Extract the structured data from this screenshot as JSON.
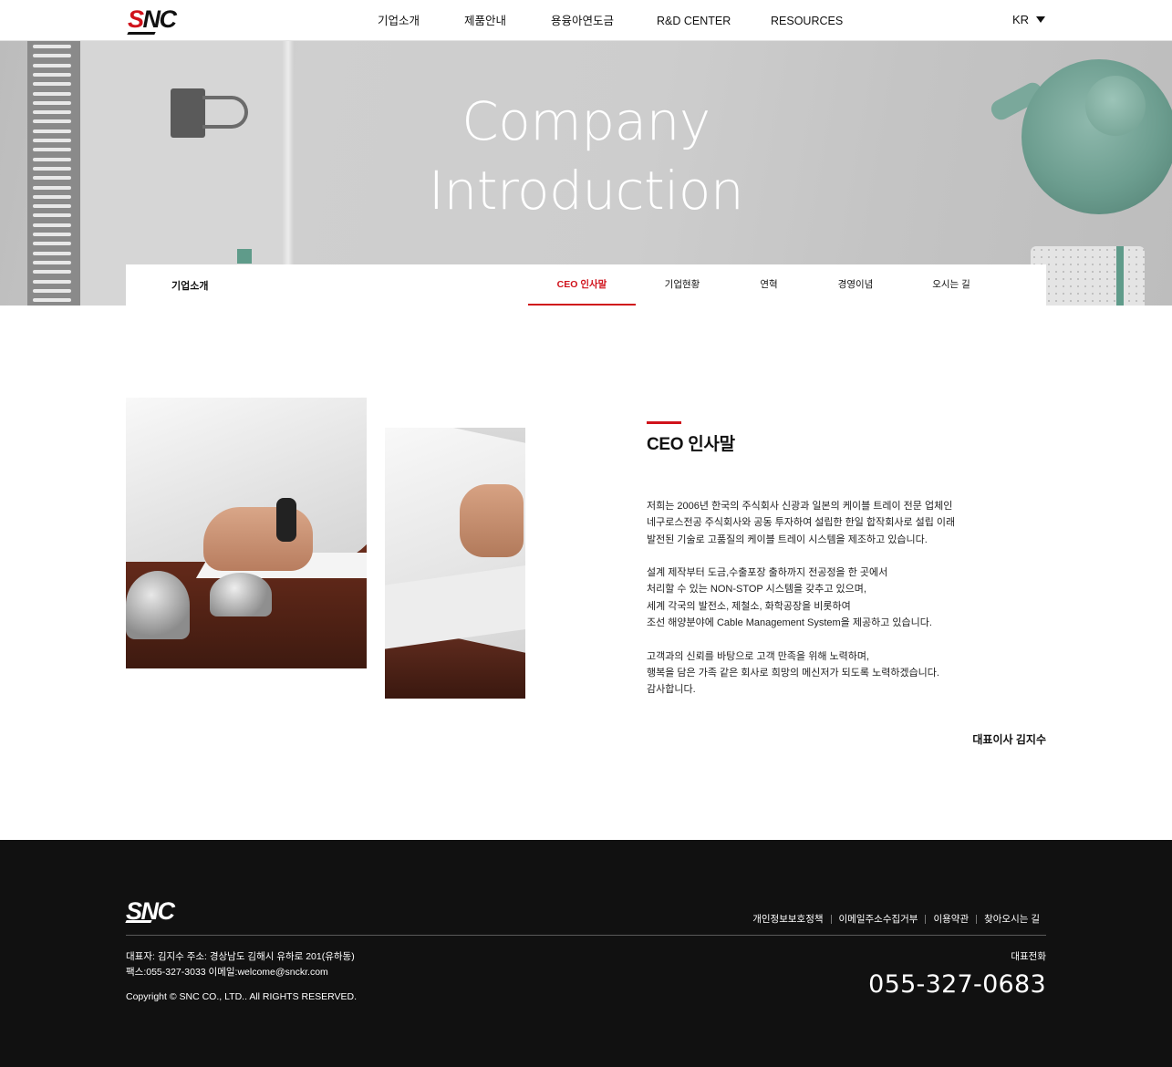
{
  "header": {
    "logo_text": "SNC",
    "nav": [
      "기업소개",
      "제품안내",
      "용융아연도금",
      "R&D CENTER",
      "RESOURCES"
    ],
    "lang": "KR"
  },
  "hero": {
    "title_line1": "Company",
    "title_line2": "Introduction"
  },
  "subnav": {
    "section": "기업소개",
    "tabs": [
      "CEO 인사말",
      "기업현황",
      "연혁",
      "경영이념",
      "오시는 길"
    ],
    "active_tab": "CEO 인사말"
  },
  "ceo": {
    "title": "CEO 인사말",
    "paragraphs": [
      [
        "저희는 2006년 한국의 주식회사 신광과 일본의 케이블 트레이 전문 업체인",
        "네구로스전공 주식회사와 공동 투자하여 설립한 한일 합작회사로 설립 이래",
        "발전된 기술로 고품질의 케이블 트레이 시스템을 제조하고 있습니다."
      ],
      [
        "설계 제작부터 도금,수출포장 출하까지 전공정을 한 곳에서",
        "처리할 수 있는 NON-STOP 시스템을 갖추고 있으며,",
        "세계 각국의 발전소, 제철소, 화학공장을 비롯하여",
        "조선 해양분야에 Cable Management System을 제공하고 있습니다."
      ],
      [
        "고객과의 신뢰를 바탕으로 고객 만족을 위해 노력하며,",
        "행복을 담은 가족 같은 회사로 희망의 메신저가 되도록 노력하겠습니다.",
        "감사합니다."
      ]
    ],
    "signature": "대표이사 김지수"
  },
  "footer": {
    "logo_text": "SNC",
    "links": [
      "개인정보보호정책",
      "이메일주소수집거부",
      "이용약관",
      "찾아오시는 길"
    ],
    "info_line1": "대표자: 김지수 주소: 경상남도 김해시 유하로 201(유하동)",
    "info_line2": "팩스:055-327-3033 이메일:welcome@snckr.com",
    "copyright": "Copyright © SNC CO., LTD.. All RIGHTS RESERVED.",
    "phone_label": "대표전화",
    "phone": "055-327-0683"
  },
  "colors": {
    "accent": "#d0121b",
    "footer_bg": "#111111",
    "teal": "#6c9d8f"
  }
}
